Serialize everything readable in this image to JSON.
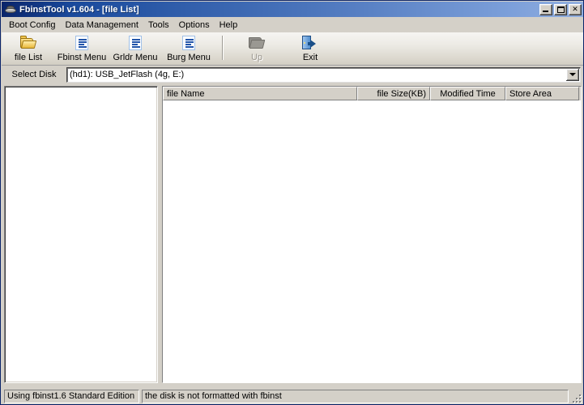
{
  "window": {
    "title": "FbinstTool v1.604 - [file List]",
    "icon": "usb-drive-icon",
    "controls": [
      {
        "name": "minimize",
        "label": "_"
      },
      {
        "name": "maximize",
        "label": "□"
      },
      {
        "name": "close",
        "label": "✕"
      }
    ]
  },
  "menubar": {
    "items": [
      {
        "label": "Boot Config"
      },
      {
        "label": "Data Management"
      },
      {
        "label": "Tools"
      },
      {
        "label": "Options"
      },
      {
        "label": "Help"
      }
    ]
  },
  "toolbar": {
    "buttons": [
      {
        "label": "file List",
        "icon": "open-folder-icon",
        "enabled": true
      },
      {
        "label": "Fbinst Menu",
        "icon": "document-list-icon",
        "enabled": true
      },
      {
        "label": "Grldr Menu",
        "icon": "document-list-icon",
        "enabled": true
      },
      {
        "label": "Burg Menu",
        "icon": "document-list-icon",
        "enabled": true
      },
      {
        "label": "Up",
        "icon": "folder-up-icon",
        "enabled": false
      },
      {
        "label": "Exit",
        "icon": "exit-door-icon",
        "enabled": true
      }
    ]
  },
  "disk_selector": {
    "label": "Select Disk",
    "value": "(hd1): USB_JetFlash (4g, E:)",
    "placeholder": "Select Disk"
  },
  "file_list": {
    "columns": [
      {
        "label": "file Name",
        "align": "left"
      },
      {
        "label": "file Size(KB)",
        "align": "right"
      },
      {
        "label": "Modified Time",
        "align": "center"
      },
      {
        "label": "Store Area",
        "align": "left"
      }
    ],
    "rows": []
  },
  "tree_panel": {
    "nodes": []
  },
  "statusbar": {
    "panel1": "Using fbinst1.6 Standard Edition",
    "panel2": "the disk is not formatted with fbinst"
  },
  "colors": {
    "title_start": "#0a246a",
    "title_end": "#93b0e0",
    "face": "#d4d0c8",
    "client": "#ffffff",
    "disabled_text": "#9a968e"
  }
}
